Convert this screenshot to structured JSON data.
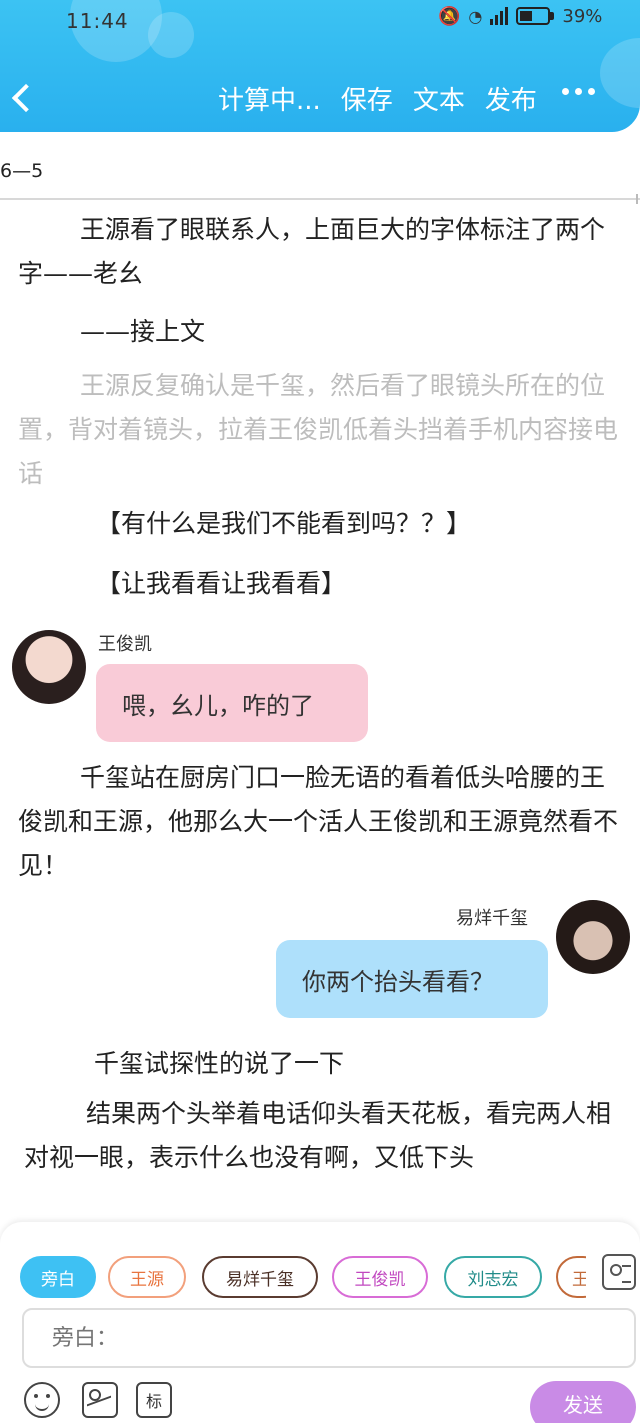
{
  "status_bar": {
    "time": "11:44",
    "battery": "39%"
  },
  "header": {
    "actions": [
      "计算中...",
      "保存",
      "文本",
      "发布"
    ]
  },
  "chapter": "6—5",
  "content": {
    "p1": "王源看了眼联系人，上面巨大的字体标注了两个字——老幺",
    "p2": "——接上文",
    "p3": "王源反复确认是千玺，然后看了眼镜头所在的位置，背对着镜头，拉着王俊凯低着头挡着手机内容接电话",
    "p4": "【有什么是我们不能看到吗？？】",
    "p5": "【让我看看让我看看】",
    "msg1": {
      "speaker": "王俊凯",
      "text": "喂，幺儿，咋的了"
    },
    "p6": "千玺站在厨房门口一脸无语的看着低头哈腰的王俊凯和王源，他那么大一个活人王俊凯和王源竟然看不见！",
    "msg2": {
      "speaker": "易烊千玺",
      "text": "你两个抬头看看？"
    },
    "p7": "千玺试探性的说了一下",
    "p8": "结果两个头举着电话仰头看天花板，看完两人相对视一眼，表示什么也没有啊，又低下头"
  },
  "composer": {
    "chips": [
      "旁白",
      "王源",
      "易烊千玺",
      "王俊凯",
      "刘志宏",
      "王"
    ],
    "input_placeholder": "旁白：",
    "mark_label": "标",
    "send_label": "发送"
  }
}
